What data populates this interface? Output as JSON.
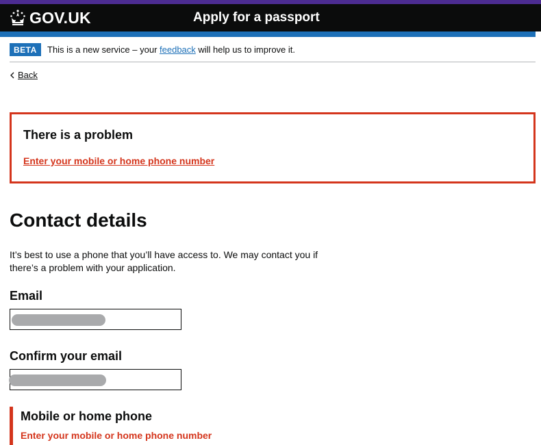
{
  "header": {
    "logo_text": "GOV.UK",
    "service_name": "Apply for a passport",
    "colors": {
      "header_bg": "#0b0c0c",
      "accent_bar": "#1d70b8",
      "top_line": "#4c2c92"
    }
  },
  "phase_banner": {
    "tag": "BETA",
    "text_before": "This is a new service – your ",
    "feedback_link": "feedback",
    "text_after": " will help us to improve it."
  },
  "back_link": {
    "label": "Back",
    "icon": "chevron-left-icon"
  },
  "error_summary": {
    "title": "There is a problem",
    "items": [
      "Enter your mobile or home phone number"
    ],
    "color": "#d4351c"
  },
  "page": {
    "title": "Contact details",
    "intro": "It’s best to use a phone that you’ll have access to. We may contact you if there’s a problem with your application."
  },
  "fields": {
    "email": {
      "label": "Email",
      "value": ""
    },
    "confirm_email": {
      "label": "Confirm your email",
      "value": ""
    },
    "phone": {
      "label": "Mobile or home phone",
      "error": "Enter your mobile or home phone number"
    }
  }
}
